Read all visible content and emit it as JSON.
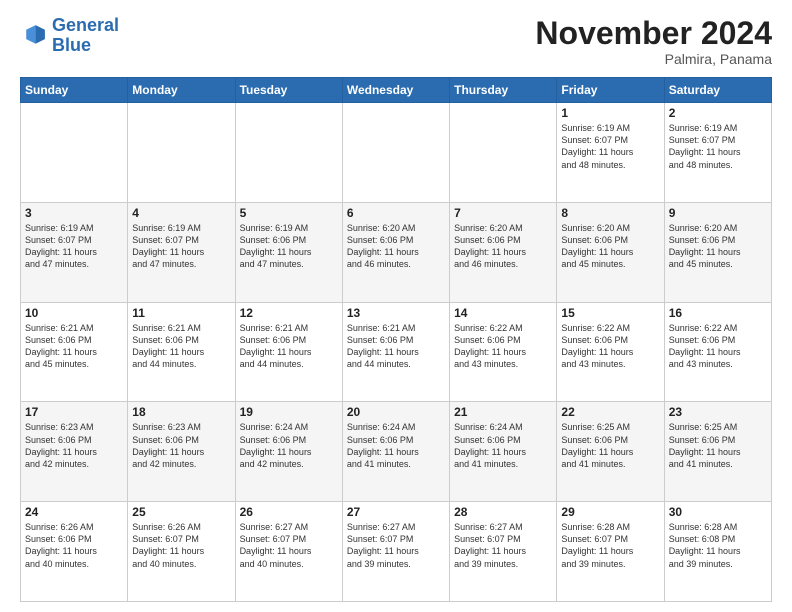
{
  "header": {
    "logo_line1": "General",
    "logo_line2": "Blue",
    "month": "November 2024",
    "location": "Palmira, Panama"
  },
  "days_of_week": [
    "Sunday",
    "Monday",
    "Tuesday",
    "Wednesday",
    "Thursday",
    "Friday",
    "Saturday"
  ],
  "weeks": [
    [
      {
        "day": "",
        "info": ""
      },
      {
        "day": "",
        "info": ""
      },
      {
        "day": "",
        "info": ""
      },
      {
        "day": "",
        "info": ""
      },
      {
        "day": "",
        "info": ""
      },
      {
        "day": "1",
        "info": "Sunrise: 6:19 AM\nSunset: 6:07 PM\nDaylight: 11 hours\nand 48 minutes."
      },
      {
        "day": "2",
        "info": "Sunrise: 6:19 AM\nSunset: 6:07 PM\nDaylight: 11 hours\nand 48 minutes."
      }
    ],
    [
      {
        "day": "3",
        "info": "Sunrise: 6:19 AM\nSunset: 6:07 PM\nDaylight: 11 hours\nand 47 minutes."
      },
      {
        "day": "4",
        "info": "Sunrise: 6:19 AM\nSunset: 6:07 PM\nDaylight: 11 hours\nand 47 minutes."
      },
      {
        "day": "5",
        "info": "Sunrise: 6:19 AM\nSunset: 6:06 PM\nDaylight: 11 hours\nand 47 minutes."
      },
      {
        "day": "6",
        "info": "Sunrise: 6:20 AM\nSunset: 6:06 PM\nDaylight: 11 hours\nand 46 minutes."
      },
      {
        "day": "7",
        "info": "Sunrise: 6:20 AM\nSunset: 6:06 PM\nDaylight: 11 hours\nand 46 minutes."
      },
      {
        "day": "8",
        "info": "Sunrise: 6:20 AM\nSunset: 6:06 PM\nDaylight: 11 hours\nand 45 minutes."
      },
      {
        "day": "9",
        "info": "Sunrise: 6:20 AM\nSunset: 6:06 PM\nDaylight: 11 hours\nand 45 minutes."
      }
    ],
    [
      {
        "day": "10",
        "info": "Sunrise: 6:21 AM\nSunset: 6:06 PM\nDaylight: 11 hours\nand 45 minutes."
      },
      {
        "day": "11",
        "info": "Sunrise: 6:21 AM\nSunset: 6:06 PM\nDaylight: 11 hours\nand 44 minutes."
      },
      {
        "day": "12",
        "info": "Sunrise: 6:21 AM\nSunset: 6:06 PM\nDaylight: 11 hours\nand 44 minutes."
      },
      {
        "day": "13",
        "info": "Sunrise: 6:21 AM\nSunset: 6:06 PM\nDaylight: 11 hours\nand 44 minutes."
      },
      {
        "day": "14",
        "info": "Sunrise: 6:22 AM\nSunset: 6:06 PM\nDaylight: 11 hours\nand 43 minutes."
      },
      {
        "day": "15",
        "info": "Sunrise: 6:22 AM\nSunset: 6:06 PM\nDaylight: 11 hours\nand 43 minutes."
      },
      {
        "day": "16",
        "info": "Sunrise: 6:22 AM\nSunset: 6:06 PM\nDaylight: 11 hours\nand 43 minutes."
      }
    ],
    [
      {
        "day": "17",
        "info": "Sunrise: 6:23 AM\nSunset: 6:06 PM\nDaylight: 11 hours\nand 42 minutes."
      },
      {
        "day": "18",
        "info": "Sunrise: 6:23 AM\nSunset: 6:06 PM\nDaylight: 11 hours\nand 42 minutes."
      },
      {
        "day": "19",
        "info": "Sunrise: 6:24 AM\nSunset: 6:06 PM\nDaylight: 11 hours\nand 42 minutes."
      },
      {
        "day": "20",
        "info": "Sunrise: 6:24 AM\nSunset: 6:06 PM\nDaylight: 11 hours\nand 41 minutes."
      },
      {
        "day": "21",
        "info": "Sunrise: 6:24 AM\nSunset: 6:06 PM\nDaylight: 11 hours\nand 41 minutes."
      },
      {
        "day": "22",
        "info": "Sunrise: 6:25 AM\nSunset: 6:06 PM\nDaylight: 11 hours\nand 41 minutes."
      },
      {
        "day": "23",
        "info": "Sunrise: 6:25 AM\nSunset: 6:06 PM\nDaylight: 11 hours\nand 41 minutes."
      }
    ],
    [
      {
        "day": "24",
        "info": "Sunrise: 6:26 AM\nSunset: 6:06 PM\nDaylight: 11 hours\nand 40 minutes."
      },
      {
        "day": "25",
        "info": "Sunrise: 6:26 AM\nSunset: 6:07 PM\nDaylight: 11 hours\nand 40 minutes."
      },
      {
        "day": "26",
        "info": "Sunrise: 6:27 AM\nSunset: 6:07 PM\nDaylight: 11 hours\nand 40 minutes."
      },
      {
        "day": "27",
        "info": "Sunrise: 6:27 AM\nSunset: 6:07 PM\nDaylight: 11 hours\nand 39 minutes."
      },
      {
        "day": "28",
        "info": "Sunrise: 6:27 AM\nSunset: 6:07 PM\nDaylight: 11 hours\nand 39 minutes."
      },
      {
        "day": "29",
        "info": "Sunrise: 6:28 AM\nSunset: 6:07 PM\nDaylight: 11 hours\nand 39 minutes."
      },
      {
        "day": "30",
        "info": "Sunrise: 6:28 AM\nSunset: 6:08 PM\nDaylight: 11 hours\nand 39 minutes."
      }
    ]
  ]
}
